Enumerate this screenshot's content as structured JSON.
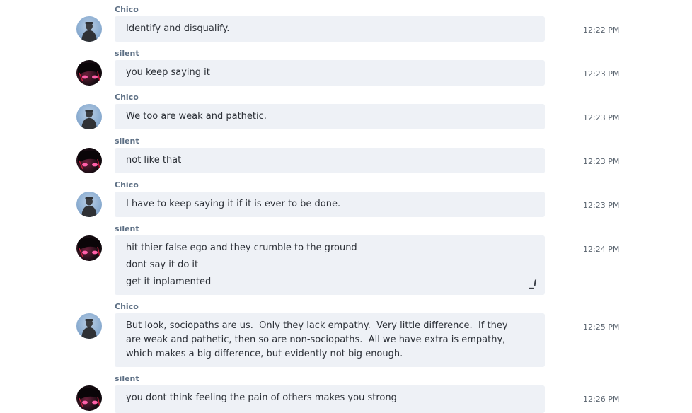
{
  "messages": [
    {
      "author": "Chico",
      "avatar_icon": "user-avatar-icon",
      "lines": [
        "Identify and disqualify."
      ],
      "time": "12:22 PM"
    },
    {
      "author": "silent",
      "avatar_icon": "user-avatar-icon",
      "lines": [
        "you keep saying it"
      ],
      "time": "12:23 PM"
    },
    {
      "author": "Chico",
      "avatar_icon": "user-avatar-icon",
      "lines": [
        "We too are weak and pathetic."
      ],
      "time": "12:23 PM"
    },
    {
      "author": "silent",
      "avatar_icon": "user-avatar-icon",
      "lines": [
        "not like that"
      ],
      "time": "12:23 PM"
    },
    {
      "author": "Chico",
      "avatar_icon": "user-avatar-icon",
      "lines": [
        "I have to keep saying it if it is ever to be done."
      ],
      "time": "12:23 PM"
    },
    {
      "author": "silent",
      "avatar_icon": "user-avatar-icon",
      "lines": [
        "hit thier false ego and they crumble to the ground",
        "dont say it do it",
        "get it inplamented"
      ],
      "time": "12:24 PM",
      "edit_glyph": "_i"
    },
    {
      "author": "Chico",
      "avatar_icon": "user-avatar-icon",
      "text": "But look, sociopaths are us.  Only they lack empathy.  Very little difference.  If they are weak and pathetic, then so are non-sociopaths.  All we have extra is empathy, which makes a big difference, but evidently not big enough.",
      "time": "12:25 PM"
    },
    {
      "author": "silent",
      "avatar_icon": "user-avatar-icon",
      "lines": [
        "you dont think feeling the pain of others makes you strong"
      ],
      "time": "12:26 PM"
    }
  ]
}
